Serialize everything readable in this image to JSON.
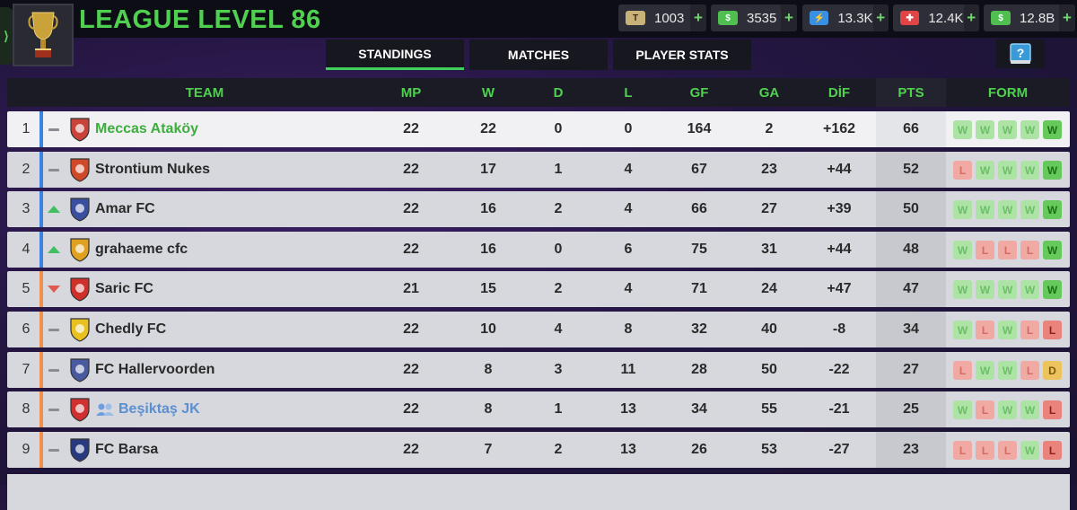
{
  "header": {
    "league_title": "LEAGUE LEVEL 86",
    "side_tab_label": "⟩",
    "currencies": [
      {
        "name": "tokens",
        "value": "1003",
        "icon": "token-icon",
        "color": "#c9b27a"
      },
      {
        "name": "cash",
        "value": "3535",
        "icon": "cash-icon",
        "color": "#4fbf4f"
      },
      {
        "name": "energy",
        "value": "13.3K",
        "icon": "energy-icon",
        "color": "#3a8fe0"
      },
      {
        "name": "medical",
        "value": "12.4K",
        "icon": "medical-icon",
        "color": "#e04444"
      },
      {
        "name": "money",
        "value": "12.8B",
        "icon": "money-icon",
        "color": "#4fbf4f"
      }
    ],
    "plus_label": "+"
  },
  "tabs": [
    {
      "label": "STANDINGS",
      "active": true
    },
    {
      "label": "MATCHES",
      "active": false
    },
    {
      "label": "PLAYER STATS",
      "active": false
    }
  ],
  "help_button": {
    "icon": "help-book-icon"
  },
  "table": {
    "columns": [
      "TEAM",
      "MP",
      "W",
      "D",
      "L",
      "GF",
      "GA",
      "DİF",
      "PTS",
      "FORM"
    ],
    "rows": [
      {
        "pos": "1",
        "trend": "same",
        "team": "Meccas Ataköy",
        "style": "green",
        "mp": "22",
        "w": "22",
        "d": "0",
        "l": "0",
        "gf": "164",
        "ga": "2",
        "dif": "+162",
        "pts": "66",
        "form": [
          "W",
          "W",
          "W",
          "W",
          "W"
        ],
        "stripe": "#3a84e0",
        "crest": "#c9433a"
      },
      {
        "pos": "2",
        "trend": "same",
        "team": "Strontium Nukes",
        "style": "normal",
        "mp": "22",
        "w": "17",
        "d": "1",
        "l": "4",
        "gf": "67",
        "ga": "23",
        "dif": "+44",
        "pts": "52",
        "form": [
          "L",
          "W",
          "W",
          "W",
          "W"
        ],
        "stripe": "#3a84e0",
        "crest": "#d04a2a"
      },
      {
        "pos": "3",
        "trend": "up",
        "team": "Amar FC",
        "style": "normal",
        "mp": "22",
        "w": "16",
        "d": "2",
        "l": "4",
        "gf": "66",
        "ga": "27",
        "dif": "+39",
        "pts": "50",
        "form": [
          "W",
          "W",
          "W",
          "W",
          "W"
        ],
        "stripe": "#3a84e0",
        "crest": "#3a4fa0"
      },
      {
        "pos": "4",
        "trend": "up",
        "team": "grahaeme cfc",
        "style": "normal",
        "mp": "22",
        "w": "16",
        "d": "0",
        "l": "6",
        "gf": "75",
        "ga": "31",
        "dif": "+44",
        "pts": "48",
        "form": [
          "W",
          "L",
          "L",
          "L",
          "W"
        ],
        "stripe": "#3a84e0",
        "crest": "#e0a020"
      },
      {
        "pos": "5",
        "trend": "down",
        "team": "Saric FC",
        "style": "normal",
        "mp": "21",
        "w": "15",
        "d": "2",
        "l": "4",
        "gf": "71",
        "ga": "24",
        "dif": "+47",
        "pts": "47",
        "form": [
          "W",
          "W",
          "W",
          "W",
          "W"
        ],
        "stripe": "#f0904a",
        "crest": "#d0302a"
      },
      {
        "pos": "6",
        "trend": "same",
        "team": "Chedly FC",
        "style": "normal",
        "mp": "22",
        "w": "10",
        "d": "4",
        "l": "8",
        "gf": "32",
        "ga": "40",
        "dif": "-8",
        "pts": "34",
        "form": [
          "W",
          "L",
          "W",
          "L",
          "L"
        ],
        "stripe": "#f0904a",
        "crest": "#e8c020"
      },
      {
        "pos": "7",
        "trend": "same",
        "team": "FC Hallervoorden",
        "style": "normal",
        "mp": "22",
        "w": "8",
        "d": "3",
        "l": "11",
        "gf": "28",
        "ga": "50",
        "dif": "-22",
        "pts": "27",
        "form": [
          "L",
          "W",
          "W",
          "L",
          "D"
        ],
        "stripe": "#f0904a",
        "crest": "#4a5aa0"
      },
      {
        "pos": "8",
        "trend": "same",
        "team": "Beşiktaş JK",
        "style": "blue",
        "friends": true,
        "mp": "22",
        "w": "8",
        "d": "1",
        "l": "13",
        "gf": "34",
        "ga": "55",
        "dif": "-21",
        "pts": "25",
        "form": [
          "W",
          "L",
          "W",
          "W",
          "L"
        ],
        "stripe": "#f0904a",
        "crest": "#d03030"
      },
      {
        "pos": "9",
        "trend": "same",
        "team": "FC Barsa",
        "style": "normal",
        "mp": "22",
        "w": "7",
        "d": "2",
        "l": "13",
        "gf": "26",
        "ga": "53",
        "dif": "-27",
        "pts": "23",
        "form": [
          "L",
          "L",
          "L",
          "W",
          "L"
        ],
        "stripe": "#f0904a",
        "crest": "#2a3a80"
      }
    ]
  }
}
